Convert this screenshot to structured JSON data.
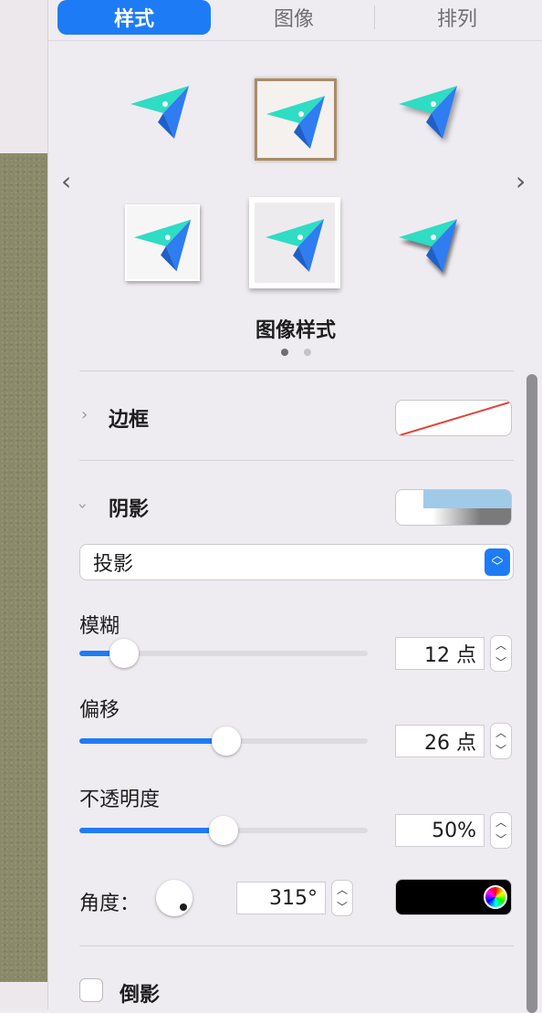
{
  "tabs": [
    {
      "label": "样式",
      "active": true
    },
    {
      "label": "图像",
      "active": false
    },
    {
      "label": "排列",
      "active": false
    }
  ],
  "styles_section": {
    "title": "图像样式",
    "page_count": 2,
    "current_page": 1,
    "prev_icon": "chevron-left-icon",
    "next_icon": "chevron-right-icon"
  },
  "border": {
    "label": "边框",
    "expanded": false
  },
  "shadow": {
    "label": "阴影",
    "expanded": true,
    "type_select": "投影",
    "blur": {
      "label": "模糊",
      "value": "12 点",
      "fraction": 0.155
    },
    "offset": {
      "label": "偏移",
      "value": "26 点",
      "fraction": 0.51
    },
    "opacity": {
      "label": "不透明度",
      "value": "50%",
      "fraction": 0.5
    },
    "angle": {
      "label": "角度：",
      "value": "315°"
    },
    "color": "#000000"
  },
  "reflection": {
    "label": "倒影",
    "checked": false
  },
  "colors": {
    "accent": "#1d7cf5",
    "border_slash": "#e0443a",
    "shadow_well_blue": "#9fcbe8"
  }
}
